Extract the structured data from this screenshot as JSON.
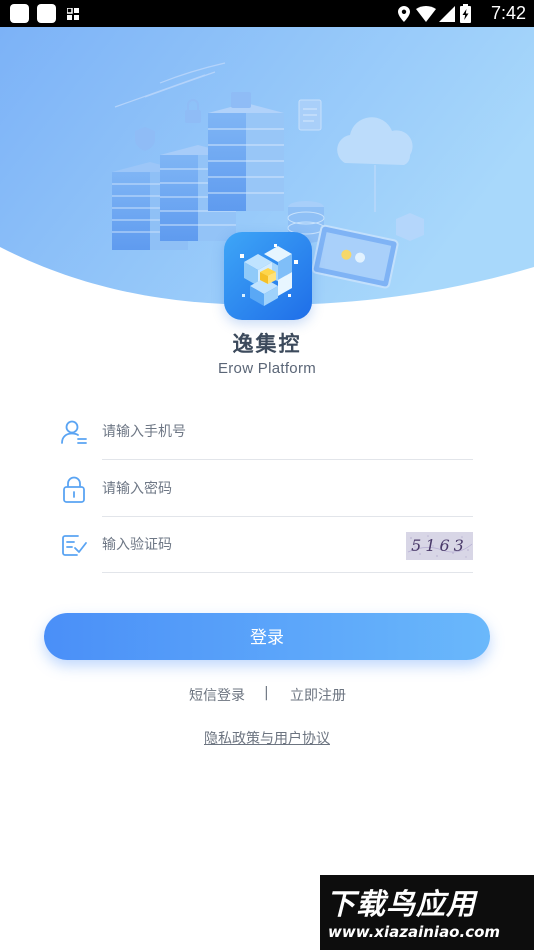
{
  "status_bar": {
    "time": "7:42",
    "icons": [
      "notification-square-icon",
      "notification-square-icon",
      "grid-icon",
      "location-icon",
      "wifi-icon",
      "signal-icon",
      "battery-charging-icon"
    ]
  },
  "header": {
    "illustration": "server-cloud-illustration",
    "app_icon": "app-logo-icon",
    "app_name": "逸集控",
    "app_subtitle": "Erow Platform"
  },
  "form": {
    "phone": {
      "icon": "user-icon",
      "placeholder": "请输入手机号",
      "value": ""
    },
    "password": {
      "icon": "lock-icon",
      "placeholder": "请输入密码",
      "value": ""
    },
    "captcha": {
      "icon": "verify-code-icon",
      "placeholder": "输入验证码",
      "value": "",
      "image_text": "5163"
    }
  },
  "actions": {
    "login_label": "登录",
    "sms_login_label": "短信登录",
    "separator": "|",
    "register_label": "立即注册",
    "privacy_label": "隐私政策与用户协议"
  },
  "watermark": {
    "title": "下载鸟应用",
    "url": "www.xiazainiao.com"
  },
  "colors": {
    "primary_gradient_start": "#4a8ff8",
    "primary_gradient_end": "#6ab8fb",
    "header_gradient_start": "#7cb2f7",
    "header_gradient_end": "#a8d8fb",
    "icon_blue": "#5aa4f3",
    "text_gray": "#6c7480"
  }
}
